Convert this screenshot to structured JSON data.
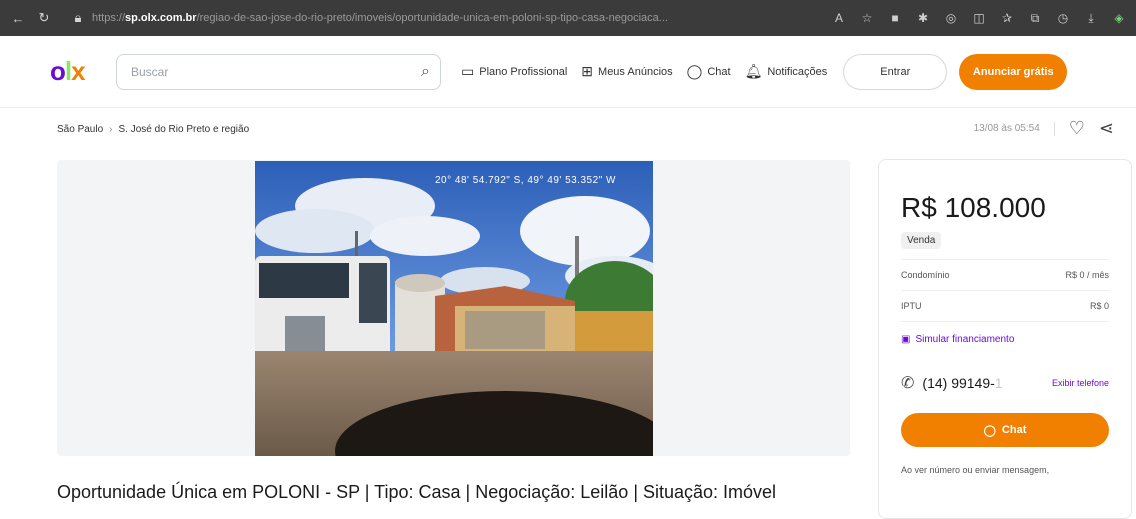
{
  "browser": {
    "url_domain": "sp.olx.com.br",
    "url_prefix": "https://",
    "url_path": "/regiao-de-sao-jose-do-rio-preto/imoveis/oportunidade-unica-em-poloni-sp-tipo-casa-negociaca..."
  },
  "header": {
    "logo": {
      "o": "o",
      "l": "l",
      "x": "x"
    },
    "search_placeholder": "Buscar",
    "nav": [
      "Plano Profissional",
      "Meus Anúncios",
      "Chat",
      "Notificações"
    ],
    "login_label": "Entrar",
    "cta_label": "Anunciar grátis"
  },
  "breadcrumb": [
    "São Paulo",
    "S. José do Rio Preto e região"
  ],
  "meta": {
    "date": "13/08 às 05:54"
  },
  "photo": {
    "coords": "20° 48' 54.792\" S, 49° 49' 53.352\" W"
  },
  "ad": {
    "title": "Oportunidade Única em POLONI - SP | Tipo: Casa | Negociação: Leilão | Situação: Imóvel"
  },
  "card": {
    "price": "R$ 108.000",
    "badge": "Venda",
    "fees": [
      {
        "label": "Condomínio",
        "value": "R$ 0 / mês"
      },
      {
        "label": "IPTU",
        "value": "R$ 0"
      }
    ],
    "simular": "Simular financiamento",
    "phone_visible": "(14) 99149-",
    "phone_hidden": "1",
    "show_phone": "Exibir telefone",
    "chat_label": "Chat",
    "note": "Ao ver número ou enviar mensagem,"
  },
  "colors": {
    "brand_orange": "#f28000",
    "brand_purple": "#6e0ad6",
    "brand_green": "#8ce563"
  }
}
